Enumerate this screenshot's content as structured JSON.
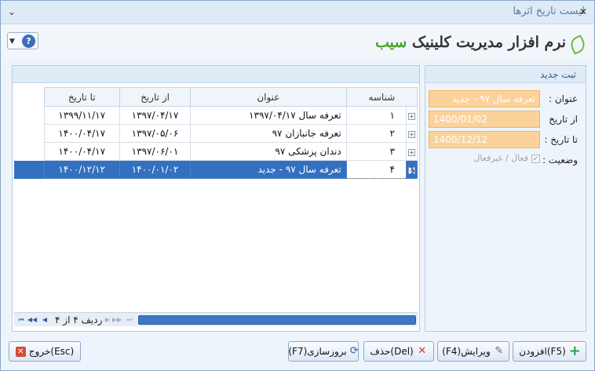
{
  "window": {
    "title": "لیست تاریخ اثرها",
    "close_glyph": "✕"
  },
  "header": {
    "logo_prefix": "نرم افزار مدیریت کلینیک",
    "logo_brand": "سیب"
  },
  "form": {
    "title": "ثبت جدید",
    "title_label": "عنوان :",
    "title_value": "تعرفه سال ۹۷ - جدید",
    "from_label": "از تاریخ",
    "from_value": "1400/01/02",
    "to_label": "تا تاریخ :",
    "to_value": "1400/12/12",
    "status_label": "وضعیت :",
    "status_option": "فعال / غیرفعال",
    "status_checked": true
  },
  "grid": {
    "columns": {
      "to": "تا تاریخ",
      "from": "از تاریخ",
      "title": "عنوان",
      "id": "شناسه"
    },
    "rows": [
      {
        "to": "۱۳۹۹/۱۱/۱۷",
        "from": "۱۳۹۷/۰۴/۱۷",
        "title": "تعرفه سال ۱۳۹۷/۰۴/۱۷",
        "id": "۱",
        "selected": false
      },
      {
        "to": "۱۴۰۰/۰۴/۱۷",
        "from": "۱۳۹۷/۰۵/۰۶",
        "title": "تعرفه جانبازان ۹۷",
        "id": "۲",
        "selected": false
      },
      {
        "to": "۱۴۰۰/۰۴/۱۷",
        "from": "۱۳۹۷/۰۶/۰۱",
        "title": "دندان پزشکی ۹۷",
        "id": "۳",
        "selected": false
      },
      {
        "to": "۱۴۰۰/۱۲/۱۲",
        "from": "۱۴۰۰/۰۱/۰۲",
        "title": "تعرفه سال ۹۷ - جدید",
        "id": "۴",
        "selected": true
      }
    ],
    "navigator_text": "ردیف ۴ از ۴"
  },
  "buttons": {
    "exit": "خروج(Esc)",
    "refresh": "(F7)بروزسازی",
    "delete": "حذف(Del)",
    "edit": "(F4)ویرایش",
    "add": "افزودن(F5)"
  }
}
